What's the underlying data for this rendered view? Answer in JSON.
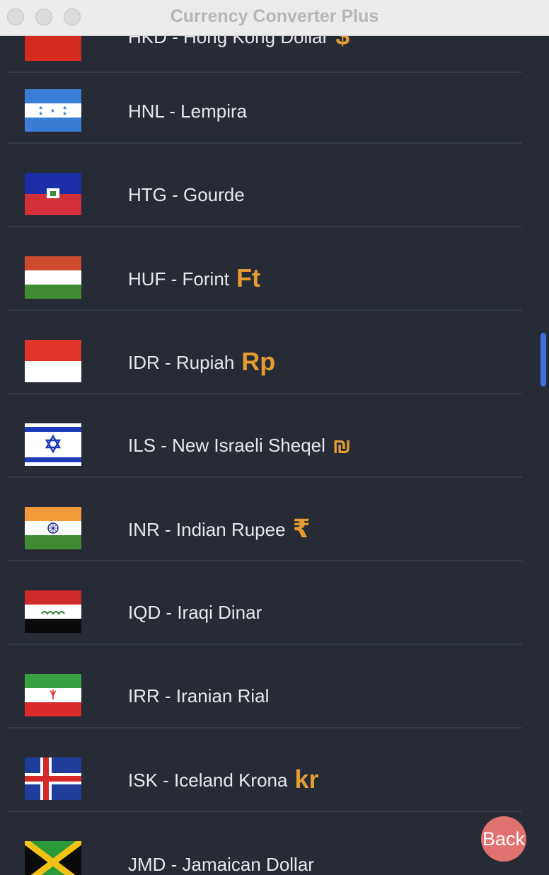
{
  "window": {
    "title": "Currency Converter Plus"
  },
  "currencies": [
    {
      "label": "HKD - Hong Kong Dollar",
      "symbol": "$"
    },
    {
      "label": "HNL - Lempira",
      "symbol": ""
    },
    {
      "label": "HTG - Gourde",
      "symbol": ""
    },
    {
      "label": "HUF - Forint",
      "symbol": "Ft"
    },
    {
      "label": "IDR - Rupiah",
      "symbol": "Rp"
    },
    {
      "label": "ILS - New Israeli Sheqel",
      "symbol": "₪"
    },
    {
      "label": "INR - Indian Rupee",
      "symbol": "₹"
    },
    {
      "label": "IQD - Iraqi Dinar",
      "symbol": ""
    },
    {
      "label": "IRR - Iranian Rial",
      "symbol": ""
    },
    {
      "label": "ISK - Iceland Krona",
      "symbol": "kr"
    },
    {
      "label": "JMD - Jamaican Dollar",
      "symbol": ""
    }
  ],
  "back_button": {
    "label": "Back"
  },
  "colors": {
    "background": "#262b36",
    "accent": "#e59b33",
    "back": "#e0726f",
    "scroll_thumb": "#3d6fe0"
  }
}
